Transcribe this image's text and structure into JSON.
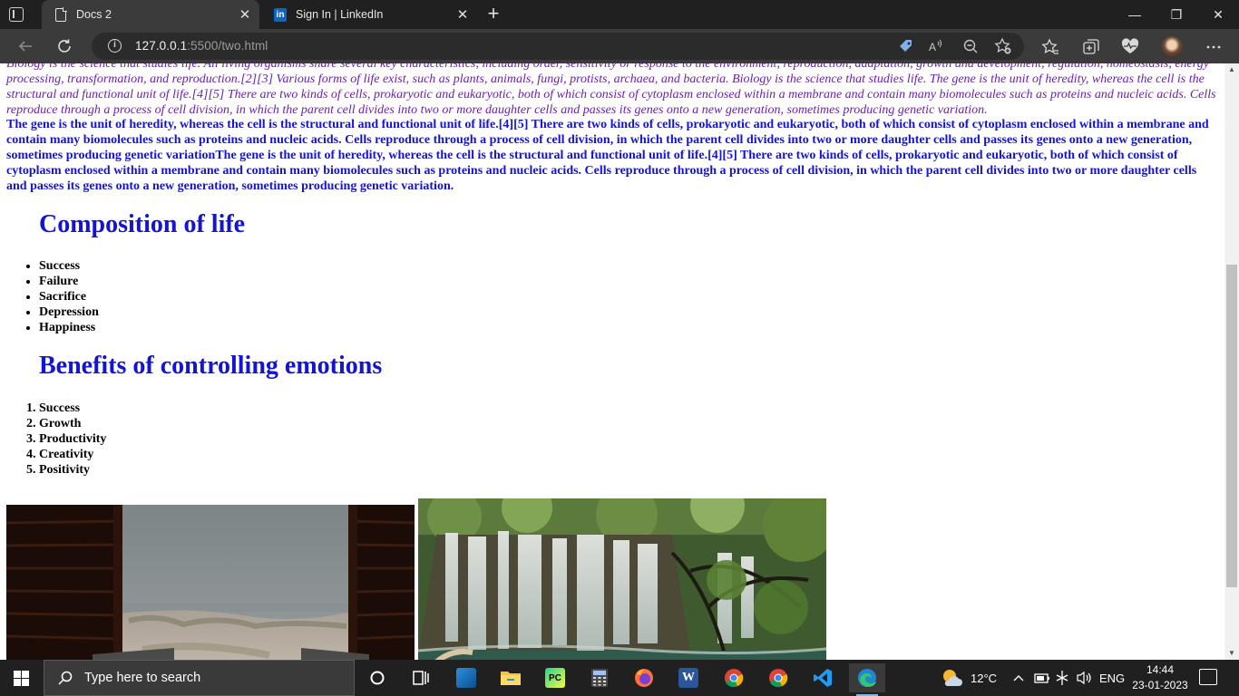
{
  "browser": {
    "tabs": [
      {
        "label": "Docs 2",
        "active": true
      },
      {
        "label": "Sign In | LinkedIn",
        "active": false
      }
    ],
    "close_glyph": "✕",
    "new_tab_glyph": "+",
    "address": {
      "host": "127.0.0.1",
      "rest": ":5500/two.html"
    },
    "window_controls": {
      "minimize": "—",
      "restore": "❐",
      "close": "✕"
    }
  },
  "page": {
    "intro_italic": "Biology is the science that studies life. All living organisms share several key characteristics, including order, sensitivity or response to the environment, reproduction, adaptation, growth and development, regulation, homeostasis, energy processing, transformation, and reproduction.[2][3] Various forms of life exist, such as plants, animals, fungi, protists, archaea, and bacteria. Biology is the science that studies life. The gene is the unit of heredity, whereas the cell is the structural and functional unit of life.[4][5] There are two kinds of cells, prokaryotic and eukaryotic, both of which consist of cytoplasm enclosed within a membrane and contain many biomolecules such as proteins and nucleic acids. Cells reproduce through a process of cell division, in which the parent cell divides into two or more daughter cells and passes its genes onto a new generation, sometimes producing genetic variation.",
    "intro_bold": "The gene is the unit of heredity, whereas the cell is the structural and functional unit of life.[4][5] There are two kinds of cells, prokaryotic and eukaryotic, both of which consist of cytoplasm enclosed within a membrane and contain many biomolecules such as proteins and nucleic acids. Cells reproduce through a process of cell division, in which the parent cell divides into two or more daughter cells and passes its genes onto a new generation, sometimes producing genetic variationThe gene is the unit of heredity, whereas the cell is the structural and functional unit of life.[4][5] There are two kinds of cells, prokaryotic and eukaryotic, both of which consist of cytoplasm enclosed within a membrane and contain many biomolecules such as proteins and nucleic acids. Cells reproduce through a process of cell division, in which the parent cell divides into two or more daughter cells and passes its genes onto a new generation, sometimes producing genetic variation.",
    "heading_composition": "Composition of life",
    "composition_items": [
      "Success",
      "Failure",
      "Sacrifice",
      "Depression",
      "Happiness"
    ],
    "heading_benefits": "Benefits of controlling emotions",
    "benefits_items": [
      "Success",
      "Growth",
      "Productivity",
      "Creativity",
      "Positivity"
    ]
  },
  "taskbar": {
    "search_placeholder": "Type here to search",
    "weather": "12°C",
    "language": "ENG",
    "time": "14:44",
    "date": "23-01-2023"
  },
  "colors": {
    "italic_text": "#6b1fb3",
    "heading": "#1414d6",
    "taskbar": "#202020",
    "tab_strip": "#202020"
  }
}
